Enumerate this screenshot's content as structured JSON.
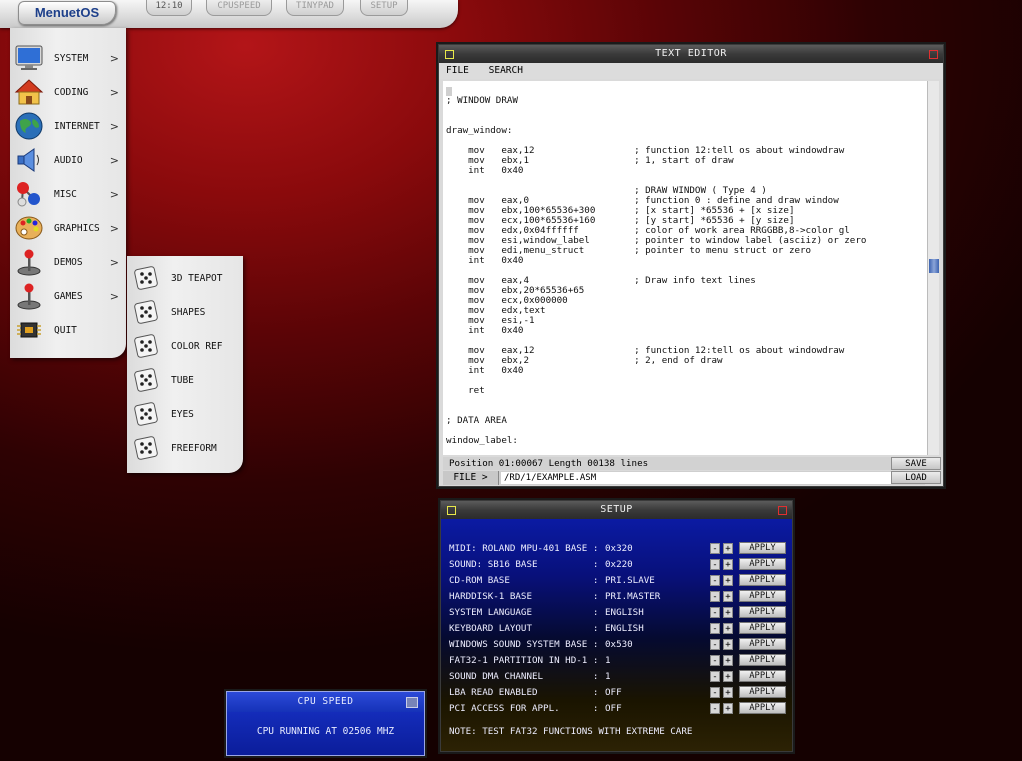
{
  "taskbar": {
    "logo": "MenuetOS",
    "clock": "12:10",
    "buttons": [
      "CPUSPEED",
      "TINYPAD",
      "SETUP"
    ]
  },
  "main_menu": {
    "items": [
      {
        "label": "SYSTEM",
        "icon": "monitor-icon",
        "submenu": true
      },
      {
        "label": "CODING",
        "icon": "house-icon",
        "submenu": true
      },
      {
        "label": "INTERNET",
        "icon": "globe-icon",
        "submenu": true
      },
      {
        "label": "AUDIO",
        "icon": "speaker-icon",
        "submenu": true
      },
      {
        "label": "MISC",
        "icon": "molecule-icon",
        "submenu": true
      },
      {
        "label": "GRAPHICS",
        "icon": "palette-icon",
        "submenu": true
      },
      {
        "label": "DEMOS",
        "icon": "joystick-icon",
        "submenu": true
      },
      {
        "label": "GAMES",
        "icon": "joystick-icon",
        "submenu": true
      },
      {
        "label": "QUIT",
        "icon": "chip-icon",
        "submenu": false
      }
    ],
    "arrow": ">"
  },
  "demos_menu": {
    "items": [
      {
        "label": "3D TEAPOT",
        "icon": "dice-icon"
      },
      {
        "label": "SHAPES",
        "icon": "dice-icon"
      },
      {
        "label": "COLOR REF",
        "icon": "dice-icon"
      },
      {
        "label": "TUBE",
        "icon": "dice-icon"
      },
      {
        "label": "EYES",
        "icon": "dice-icon"
      },
      {
        "label": "FREEFORM",
        "icon": "dice-icon"
      }
    ]
  },
  "text_editor": {
    "title": "TEXT EDITOR",
    "menu": [
      "FILE",
      "SEARCH"
    ],
    "code": "\n; WINDOW DRAW\n\n\ndraw_window:\n\n    mov   eax,12                  ; function 12:tell os about windowdraw\n    mov   ebx,1                   ; 1, start of draw\n    int   0x40\n\n                                  ; DRAW WINDOW ( Type 4 )\n    mov   eax,0                   ; function 0 : define and draw window\n    mov   ebx,100*65536+300       ; [x start] *65536 + [x size]\n    mov   ecx,100*65536+160       ; [y start] *65536 + [y size]\n    mov   edx,0x04ffffff          ; color of work area RRGGBB,8->color gl\n    mov   esi,window_label        ; pointer to window label (asciiz) or zero\n    mov   edi,menu_struct         ; pointer to menu struct or zero\n    int   0x40\n\n    mov   eax,4                   ; Draw info text lines\n    mov   ebx,20*65536+65\n    mov   ecx,0x000000\n    mov   edx,text\n    mov   esi,-1\n    int   0x40\n\n    mov   eax,12                  ; function 12:tell os about windowdraw\n    mov   ebx,2                   ; 2, end of draw\n    int   0x40\n\n    ret\n\n\n; DATA AREA\n\nwindow_label:",
    "status": "Position 01:00067   Length 00138 lines",
    "file_button": "FILE >",
    "path": "/RD/1/EXAMPLE.ASM",
    "save_label": "SAVE",
    "load_label": "LOAD"
  },
  "setup": {
    "title": "SETUP",
    "apply_label": "APPLY",
    "minus": "-",
    "plus": "+",
    "rows": [
      {
        "name": "MIDI: ROLAND MPU-401 BASE :",
        "value": "0x320"
      },
      {
        "name": "SOUND: SB16 BASE          :",
        "value": "0x220"
      },
      {
        "name": "CD-ROM BASE               :",
        "value": "PRI.SLAVE"
      },
      {
        "name": "HARDDISK-1 BASE           :",
        "value": "PRI.MASTER"
      },
      {
        "name": "SYSTEM LANGUAGE           :",
        "value": "ENGLISH"
      },
      {
        "name": "KEYBOARD LAYOUT           :",
        "value": "ENGLISH"
      },
      {
        "name": "WINDOWS SOUND SYSTEM BASE :",
        "value": "0x530"
      },
      {
        "name": "FAT32-1 PARTITION IN HD-1 :",
        "value": "1"
      },
      {
        "name": "SOUND DMA CHANNEL         :",
        "value": "1"
      },
      {
        "name": "LBA READ ENABLED          :",
        "value": "OFF"
      },
      {
        "name": "PCI ACCESS FOR APPL.      :",
        "value": "OFF"
      }
    ],
    "note": "NOTE: TEST FAT32 FUNCTIONS WITH EXTREME CARE"
  },
  "cpu_speed": {
    "title": "CPU SPEED",
    "message": "CPU RUNNING AT 02506 MHZ"
  }
}
